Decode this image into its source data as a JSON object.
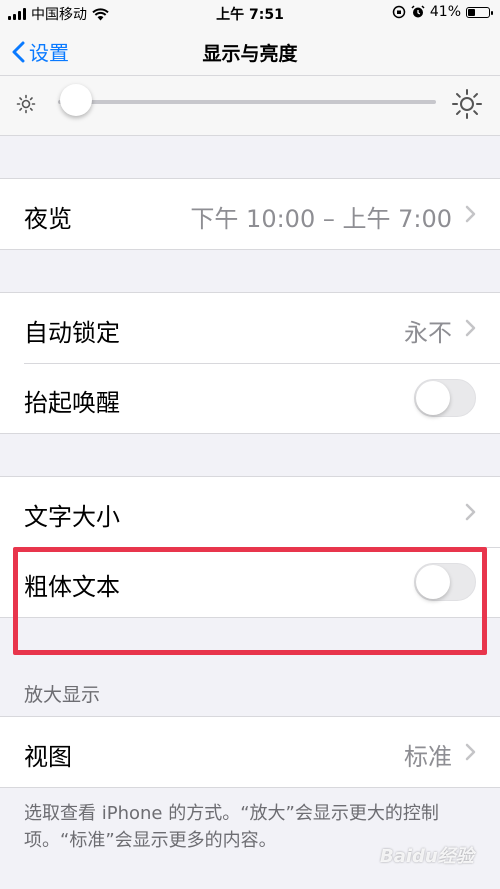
{
  "status_bar": {
    "carrier": "中国移动",
    "time": "上午 7:51",
    "battery_percent": "41%",
    "battery_level": 0.41
  },
  "nav": {
    "back_label": "设置",
    "title": "显示与亮度"
  },
  "brightness": {
    "level": 0.02
  },
  "night_shift": {
    "label": "夜览",
    "value": "下午 10:00 – 上午 7:00"
  },
  "auto_lock": {
    "label": "自动锁定",
    "value": "永不"
  },
  "raise_to_wake": {
    "label": "抬起唤醒",
    "on": false
  },
  "text_size": {
    "label": "文字大小"
  },
  "bold_text": {
    "label": "粗体文本",
    "on": false
  },
  "zoom_section": {
    "header": "放大显示"
  },
  "view": {
    "label": "视图",
    "value": "标准"
  },
  "footer": {
    "note": "选取查看 iPhone 的方式。“放大”会显示更大的控制项。“标准”会显示更多的内容。"
  },
  "watermark": "Baidu经验",
  "colors": {
    "accent": "#0a7aff",
    "highlight": "#e8354c",
    "toggle_off": "#e9e9eb"
  }
}
